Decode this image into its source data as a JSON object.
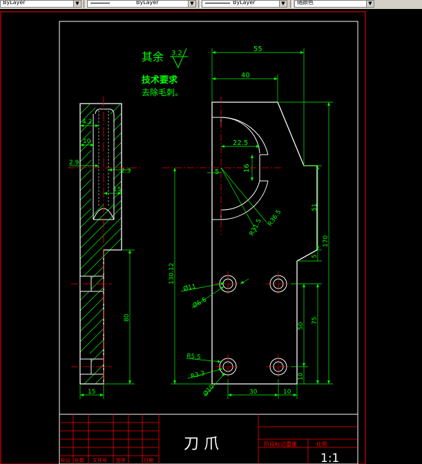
{
  "toolbar": {
    "layer_value": "ByLayer",
    "linetype_value": "ByLayer",
    "lineweight_value": "ByLayer",
    "color_value": "随颜色"
  },
  "colors": {
    "background": "#000000",
    "border": "#ff0000",
    "dimension": "#00ff00",
    "center_line": "#ff0000",
    "object_line": "#ffffff",
    "hatch": "#00ff00"
  },
  "notes": {
    "roughness_label": "其余",
    "roughness_value": "3.2",
    "tech_title": "技术要求",
    "tech_line1": "去除毛刺。"
  },
  "side_view_dims": {
    "d_4_2": "4.2",
    "d_10": "10",
    "d_2_9": "2.9",
    "d_2_3": "2.3",
    "d_15_small": "15",
    "d_80": "80",
    "d_15_bottom": "15"
  },
  "front_view_dims": {
    "d_55": "55",
    "d_40": "40",
    "d_22_5": "22.5",
    "d_5_top": "5",
    "d_16": "16",
    "r_36_5": "R36.5",
    "r_31_5": "R31.5",
    "d_51": "51",
    "d_170": "170",
    "d_5_right": "5",
    "d_130_12": "130.12",
    "phi_11": "Ø11",
    "phi_6_6": "Ø6.6",
    "d_50": "50",
    "d_75": "75",
    "r_5_5": "R5.5",
    "r_3_3": "R3.3",
    "phi_10": "Ø10",
    "d_10_right": "10",
    "d_30": "30",
    "d_10_bottom": "10"
  },
  "title_block": {
    "part_name": "刀 爪",
    "scale": "1:1",
    "label_weight": "重量",
    "label_ratio": "比例",
    "label_stage": "阶段标记",
    "row_labels": [
      "标记",
      "处数",
      "文件号",
      "签字",
      "日期"
    ]
  }
}
